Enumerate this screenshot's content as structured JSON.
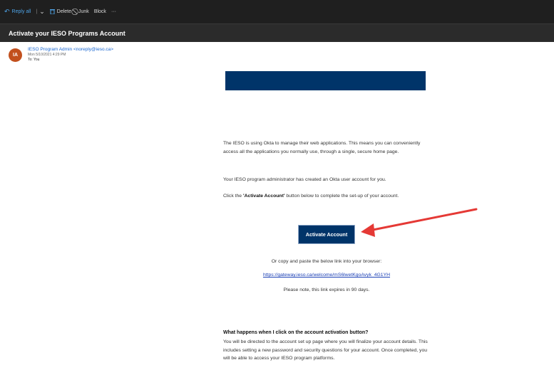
{
  "toolbar": {
    "reply_all": "Reply all",
    "delete": "Delete",
    "junk": "Junk",
    "block": "Block",
    "more": "···"
  },
  "subject": "Activate your IESO Programs Account",
  "sender": {
    "initials": "IA",
    "name": "IESO Program Admin <noreply@ieso.ca>",
    "date": "Mon 5/10/2021 4:29 PM",
    "to": "To: You"
  },
  "email": {
    "para1": "The IESO is using Okta to manage their web applications. This means you can conveniently access all the applications you normally use, through a single, secure home page.",
    "para2": "Your IESO program administrator has created an Okta user account for you.",
    "para3_prefix": "Click the ",
    "para3_bold": "'Activate Account'",
    "para3_suffix": " button below to complete the set-up of your account.",
    "button": "Activate Account",
    "copy_text": "Or copy and paste the below link into your browser:",
    "link": "https://gateway.ieso.ca/welcome/mS6lwetKgoAvyk_4G1YH",
    "expires": "Please note, this link expires in 90 days.",
    "faq_question": "What happens when I click on the account activation button?",
    "faq_answer": "You will be directed to the account set up page where you will finalize your account details. This includes setting a new password and security questions for your account. Once completed, you will be able to access your IESO program platforms."
  },
  "colors": {
    "brand_navy": "#003469",
    "annotation_arrow": "#e53935",
    "link_blue": "#1a3fb5"
  }
}
